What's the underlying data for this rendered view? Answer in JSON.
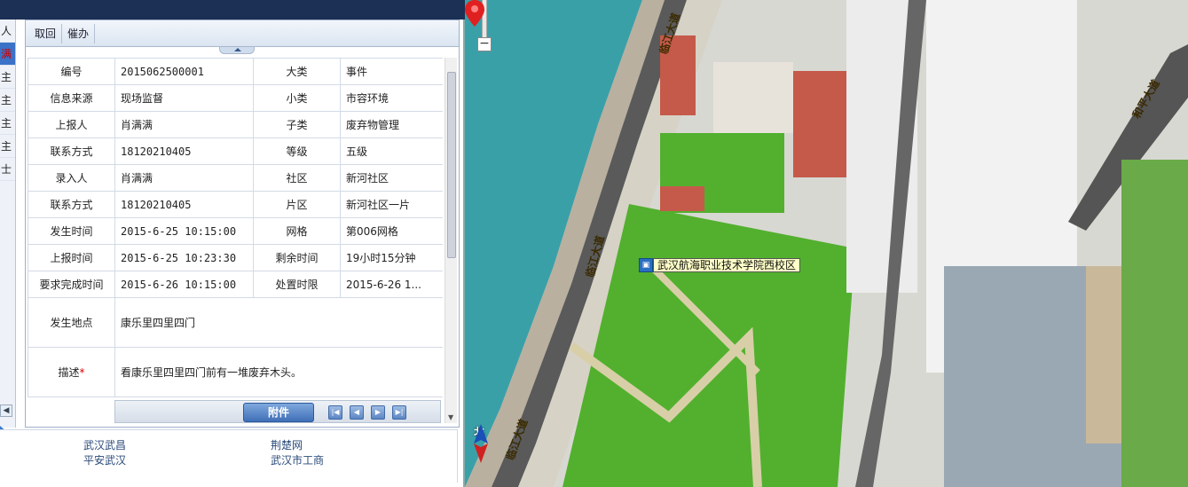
{
  "toolbar": {
    "cancel_label": "取回",
    "urge_label": "催办"
  },
  "stub_rows": [
    "人",
    "满",
    "主",
    "主",
    "主",
    "主",
    "士"
  ],
  "form": {
    "rows": [
      {
        "l1": "编号",
        "v1": "2015062500001",
        "l2": "大类",
        "v2": "事件"
      },
      {
        "l1": "信息来源",
        "v1": "现场监督",
        "l2": "小类",
        "v2": "市容环境"
      },
      {
        "l1": "上报人",
        "v1": "肖满满",
        "l2": "子类",
        "v2": "废弃物管理"
      },
      {
        "l1": "联系方式",
        "v1": "18120210405",
        "l2": "等级",
        "v2": "五级"
      },
      {
        "l1": "录入人",
        "v1": "肖满满",
        "l2": "社区",
        "v2": "新河社区"
      },
      {
        "l1": "联系方式",
        "v1": "18120210405",
        "l2": "片区",
        "v2": "新河社区一片"
      },
      {
        "l1": "发生时间",
        "v1": "2015-6-25 10:15:00",
        "l2": "网格",
        "v2": "第006网格"
      },
      {
        "l1": "上报时间",
        "v1": "2015-6-25 10:23:30",
        "l2": "剩余时间",
        "v2": "19小时15分钟"
      },
      {
        "l1": "要求完成时间",
        "v1": "2015-6-26 10:15:00",
        "l2": "处置时限",
        "v2": "2015-6-26 1..."
      }
    ],
    "location_label": "发生地点",
    "location_value": "康乐里四里四门",
    "desc_label": "描述",
    "desc_required": "*",
    "desc_value": "看康乐里四里四门前有一堆废弃木头。"
  },
  "attach": {
    "label": "附件"
  },
  "footer": {
    "links": [
      "武汉武昌",
      "平安武汉",
      "荆楚网",
      "武汉市工商"
    ]
  },
  "map": {
    "poi_label": "武汉航海职业技术学院西校区",
    "roads": [
      "临江大道",
      "临江大道",
      "临江大道",
      "和平大道"
    ],
    "compass_label": "北",
    "zoom_out": "−"
  },
  "colors": {
    "water": "#3aa0a8",
    "grass": "#52b02e",
    "road": "#5a5a5a",
    "toolbar": "#1c2f55"
  }
}
